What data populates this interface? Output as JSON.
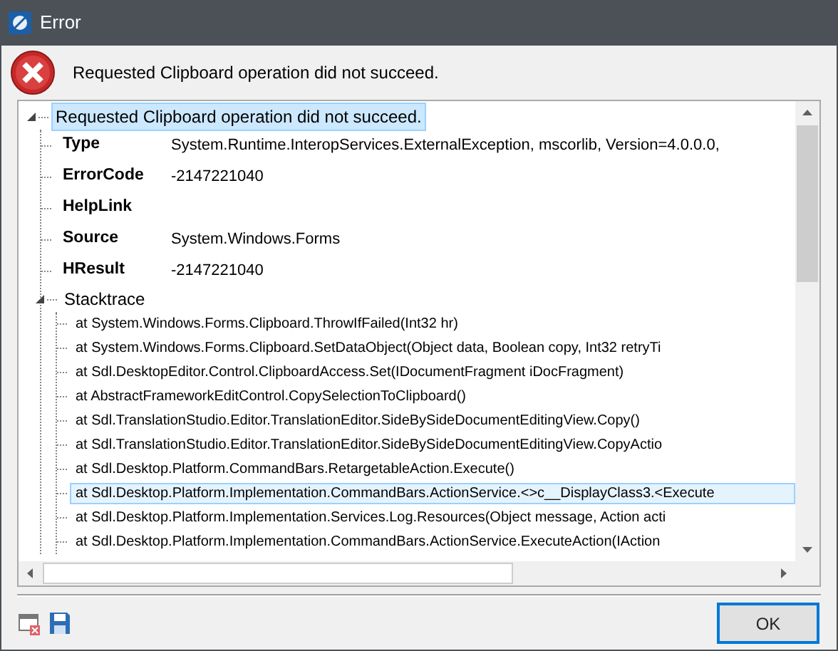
{
  "window": {
    "title": "Error"
  },
  "message": "Requested Clipboard operation did not succeed.",
  "tree": {
    "label": "Requested Clipboard operation did not succeed.",
    "expanded": true,
    "selected": true,
    "children": [
      {
        "kind": "property",
        "name": "Type",
        "value": "System.Runtime.InteropServices.ExternalException, mscorlib, Version=4.0.0.0,",
        "selected": false
      },
      {
        "kind": "property",
        "name": "ErrorCode",
        "value": "-2147221040",
        "selected": false
      },
      {
        "kind": "property",
        "name": "HelpLink",
        "selected": false
      },
      {
        "kind": "property",
        "name": "Source",
        "value": "System.Windows.Forms",
        "selected": false
      },
      {
        "kind": "property",
        "name": "HResult",
        "value": "-2147221040",
        "selected": false
      },
      {
        "kind": "group",
        "label": "Stacktrace",
        "expanded": true,
        "selected": false,
        "children": [
          {
            "label": "at System.Windows.Forms.Clipboard.ThrowIfFailed(Int32 hr)",
            "selected": false
          },
          {
            "label": "at System.Windows.Forms.Clipboard.SetDataObject(Object data, Boolean copy, Int32 retryTi",
            "selected": false
          },
          {
            "label": "at Sdl.DesktopEditor.Control.ClipboardAccess.Set(IDocumentFragment iDocFragment)",
            "selected": false
          },
          {
            "label": "at AbstractFrameworkEditControl.CopySelectionToClipboard()",
            "selected": false
          },
          {
            "label": "at Sdl.TranslationStudio.Editor.TranslationEditor.SideBySideDocumentEditingView.Copy()",
            "selected": false
          },
          {
            "label": "at Sdl.TranslationStudio.Editor.TranslationEditor.SideBySideDocumentEditingView.CopyActio",
            "selected": false
          },
          {
            "label": "at Sdl.Desktop.Platform.CommandBars.RetargetableAction.Execute()",
            "selected": false
          },
          {
            "label": "at  Sdl.Desktop.Platform.Implementation.CommandBars.ActionService.<>c__DisplayClass3.<Execute",
            "selected": true
          },
          {
            "label": "at Sdl.Desktop.Platform.Implementation.Services.Log.Resources(Object message, Action acti",
            "selected": false
          },
          {
            "label": "at Sdl.Desktop.Platform.Implementation.CommandBars.ActionService.ExecuteAction(IAction",
            "selected": false
          }
        ]
      }
    ]
  },
  "buttons": [
    {
      "label": "OK",
      "default": true
    }
  ]
}
